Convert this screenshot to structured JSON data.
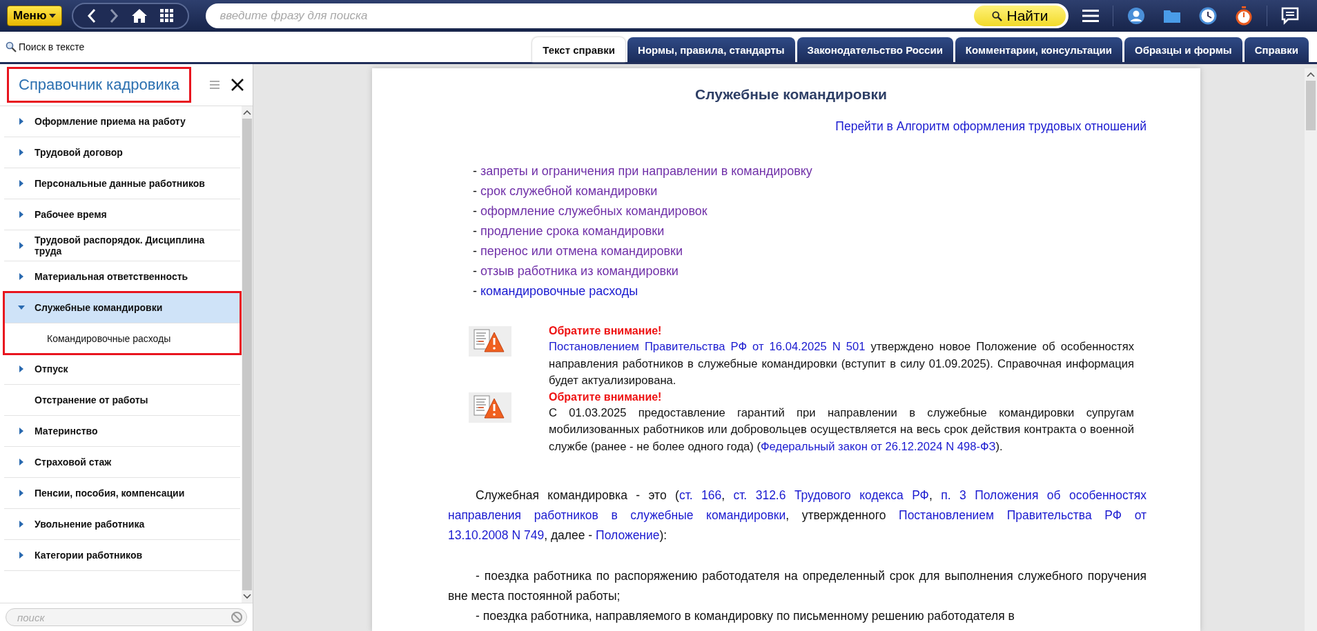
{
  "topbar": {
    "menu_label": "Меню",
    "search": {
      "placeholder": "введите фразу для поиска"
    },
    "find_label": "Найти"
  },
  "text_search_label": "Поиск в тексте",
  "tabs": [
    {
      "label": "Текст справки",
      "selected": true
    },
    {
      "label": "Нормы, правила, стандарты",
      "selected": false
    },
    {
      "label": "Законодательство России",
      "selected": false
    },
    {
      "label": "Комментарии, консультации",
      "selected": false
    },
    {
      "label": "Образцы и формы",
      "selected": false
    },
    {
      "label": "Справки",
      "selected": false
    }
  ],
  "sidebar": {
    "title": "Справочник кадровика",
    "title_highlighted": true,
    "items": [
      {
        "label": "Оформление приема на работу",
        "expanded": false,
        "has_children": true,
        "highlighted": false,
        "selected": false
      },
      {
        "label": "Трудовой договор",
        "expanded": false,
        "has_children": true,
        "highlighted": false,
        "selected": false
      },
      {
        "label": "Персональные данные работников",
        "expanded": false,
        "has_children": true,
        "highlighted": false,
        "selected": false
      },
      {
        "label": "Рабочее время",
        "expanded": false,
        "has_children": true,
        "highlighted": false,
        "selected": false
      },
      {
        "label": "Трудовой распорядок. Дисциплина труда",
        "expanded": false,
        "has_children": true,
        "highlighted": false,
        "selected": false
      },
      {
        "label": "Материальная ответственность",
        "expanded": false,
        "has_children": true,
        "highlighted": false,
        "selected": false
      },
      {
        "label": "Служебные командировки",
        "expanded": true,
        "has_children": true,
        "highlighted": true,
        "selected": true,
        "children": [
          {
            "label": "Командировочные расходы"
          }
        ]
      },
      {
        "label": "Отпуск",
        "expanded": false,
        "has_children": true,
        "highlighted": false,
        "selected": false
      },
      {
        "label": "Отстранение от работы",
        "has_children": false,
        "highlighted": false,
        "selected": false
      },
      {
        "label": "Материнство",
        "expanded": false,
        "has_children": true,
        "highlighted": false,
        "selected": false
      },
      {
        "label": "Страховой стаж",
        "expanded": false,
        "has_children": true,
        "highlighted": false,
        "selected": false
      },
      {
        "label": "Пенсии, пособия, компенсации",
        "expanded": false,
        "has_children": true,
        "highlighted": false,
        "selected": false
      },
      {
        "label": "Увольнение работника",
        "expanded": false,
        "has_children": true,
        "highlighted": false,
        "selected": false
      },
      {
        "label": "Категории работников",
        "expanded": false,
        "has_children": true,
        "highlighted": false,
        "selected": false
      }
    ],
    "search": {
      "placeholder": "поиск"
    }
  },
  "document": {
    "title": "Служебные командировки",
    "algorithm_link": "Перейти в Алгоритм оформления трудовых отношений",
    "toc": [
      {
        "dash": "-",
        "label": "запреты и ограничения при направлении в командировку",
        "visited": true
      },
      {
        "dash": "-",
        "label": "срок служебной командировки",
        "visited": true
      },
      {
        "dash": "-",
        "label": "оформление служебных командировок",
        "visited": true
      },
      {
        "dash": "-",
        "label": "продление срока командировки",
        "visited": true
      },
      {
        "dash": "-",
        "label": "перенос или отмена командировки",
        "visited": true
      },
      {
        "dash": "-",
        "label": "отзыв работника из командировки",
        "visited": true
      },
      {
        "dash": "-",
        "label": "командировочные расходы",
        "visited": false
      }
    ],
    "notices": [
      {
        "heading": "Обратите внимание!",
        "segments": [
          {
            "t": "Постановлением Правительства РФ от 16.04.2025 N 501",
            "link": true
          },
          {
            "t": " утверждено новое Положение об особенностях направления работников в служебные командировки (вступит в силу 01.09.2025). Справочная информация будет актуализирована."
          }
        ]
      },
      {
        "heading": "Обратите внимание!",
        "segments": [
          {
            "t": "С 01.03.2025 предоставление гарантий при направлении в служебные командировки супругам мобилизованных работников или добровольцев осуществляется на весь срок действия контракта о военной службе (ранее - не более одного года) ("
          },
          {
            "t": "Федеральный закон от 26.12.2024 N 498-ФЗ",
            "link": true
          },
          {
            "t": ")."
          }
        ]
      }
    ],
    "paragraphs": [
      {
        "segments": [
          {
            "t": "Служебная командировка - это ("
          },
          {
            "t": "ст. 166",
            "link": true
          },
          {
            "t": ", "
          },
          {
            "t": "ст. 312.6 Трудового кодекса РФ",
            "link": true
          },
          {
            "t": ", "
          },
          {
            "t": "п. 3 Положения об особенностях",
            "link": true
          },
          {
            "t": "направления работников в служебные командировки",
            "link": true
          },
          {
            "t": ", утвержденного "
          },
          {
            "t": "Постановлением Правительства РФ от",
            "link": true
          },
          {
            "t": "13.10.2008 N 749",
            "link": true
          },
          {
            "t": ", далее - "
          },
          {
            "t": "Положение",
            "link": true
          },
          {
            "t": "):"
          }
        ]
      },
      {
        "segments": [
          {
            "t": "- поездка работника по распоряжению работодателя на определенный срок для выполнения служебного поручения вне места постоянной работы;"
          }
        ]
      },
      {
        "segments": [
          {
            "t": "- поездка работника, направляемого в командировку по письменному решению работодателя в"
          }
        ]
      }
    ]
  }
}
